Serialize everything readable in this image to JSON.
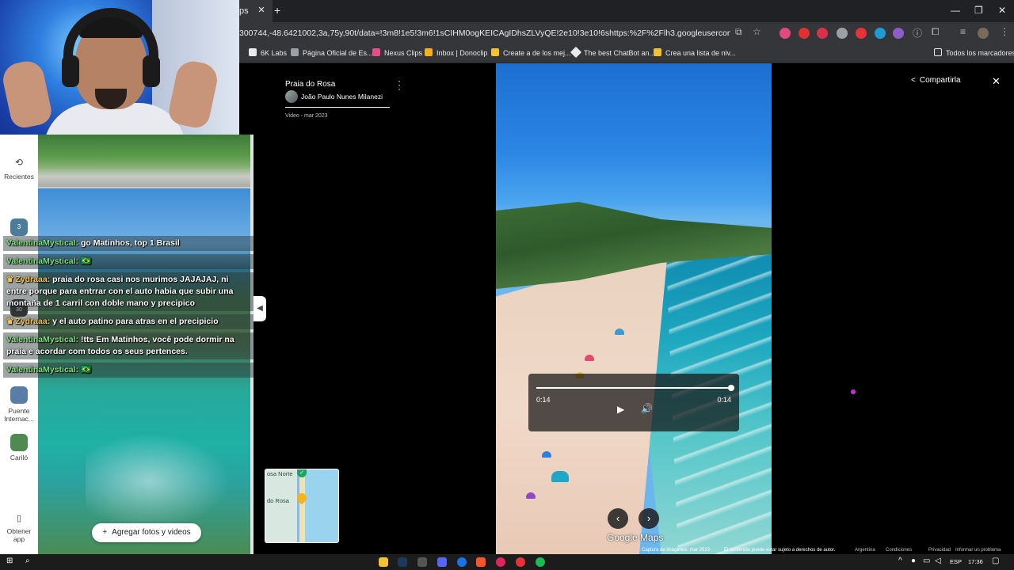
{
  "browser": {
    "tab_partial_label": "ps",
    "tab_close": "✕",
    "new_tab": "+",
    "url": "300744,-48.6421002,3a,75y,90t/data=!3m8!1e5!3m6!1sCIHM0ogKEICAgIDhsZLVyQE!2e10!3e10!6shttps:%2F%2Flh3.googleusercontent.com%2Fgps-...",
    "window_controls": {
      "minimize": "—",
      "maximize": "❐",
      "close": "✕"
    }
  },
  "bookmarks": [
    {
      "label": "6K Labs",
      "color": "#e8eaed"
    },
    {
      "label": "Página Oficial de Es...",
      "color": "#9aa0a6"
    },
    {
      "label": "Nexus Clips",
      "color": "#ea4c89"
    },
    {
      "label": "Inbox | Donoclip",
      "color": "#f6b11a"
    },
    {
      "label": "Create a de los mej...",
      "color": "#f2c233"
    },
    {
      "label": "The best ChatBot an...",
      "color": "#e8eaed"
    },
    {
      "label": "Crea una lista de niv...",
      "color": "#f2c233"
    }
  ],
  "bookmarks_all": "Todos los marcadores",
  "leftnav": {
    "recents_label": "Recientes",
    "badge_3": "3",
    "badge_30": "30",
    "puente_label": "Puente Internac...",
    "carilo_label": "Cariló",
    "app_label": "Obtener app"
  },
  "chat": [
    {
      "user": "ValentinaMystical:",
      "text": "go Matinhos, top 1 Brasil",
      "crown": false
    },
    {
      "user": "ValentinaMystical:",
      "text": "🇧🇷",
      "crown": false
    },
    {
      "user": "Zydraaa:",
      "text": "praia do rosa casi nos murimos JAJAJAJ, ni entre porque para entrrar con el auto habia que subir una montaña de 1 carril con doble mano y precipico",
      "crown": true
    },
    {
      "user": "Zydraaa:",
      "text": "y el auto patino para atras en el precipicio",
      "crown": true
    },
    {
      "user": "ValentinaMystical:",
      "text": "!tts Em Matinhos, você pode dormir na praia e acordar com todos os seus pertences.",
      "crown": false
    },
    {
      "user": "ValentinaMystical:",
      "text": "🇧🇷",
      "crown": false
    }
  ],
  "add_photos": "Agregar fotos y videos",
  "viewer": {
    "title": "Praia do Rosa",
    "author": "João Paulo Nunes Milanezi",
    "date": "Video - mar 2023",
    "share": "Compartirla",
    "current_time": "0:14",
    "duration": "0:14",
    "progress": 1.0,
    "google_maps": "Google Maps"
  },
  "minimap": {
    "label_top": "osa Norte",
    "label_mid": "do Rosa"
  },
  "footer": {
    "capture": "Captura de imágenes: mar 2023",
    "rights": "El contenido puede estar sujeto a derechos de autor.",
    "country": "Argentina",
    "terms": "Condiciones",
    "privacy": "Privacidad",
    "report": "Informar un problema"
  },
  "taskbar": {
    "lang": "ESP",
    "time": "17:36"
  },
  "icons": {
    "tab_close": "close-icon",
    "play": "play-icon",
    "volume": "volume-icon",
    "share": "share-icon",
    "prev": "chevron-left-icon",
    "next": "chevron-right-icon"
  }
}
